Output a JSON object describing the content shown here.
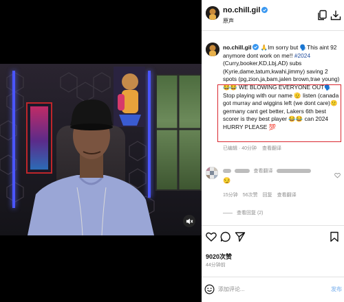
{
  "video": {
    "mute_icon": "speaker-muted-icon"
  },
  "header": {
    "username": "no.chill.gil",
    "subtitle": "原声",
    "icons": [
      "copy-icon",
      "download-icon"
    ]
  },
  "post": {
    "username": "no.chill.gil",
    "caption_part1": "🙏Im sorry but 🗣️This aint 92 anymore dont work on me!! ",
    "hashtag": "#2024",
    "caption_part2": " (Curry,booker,KD,Lbj,AD) subs (Kyrie,dame,tatum,kwahi,jimmy) saving 2 spots ",
    "caption_highlight": "(pg,zion,ja,bam,jalen brown,trae young) 😂😂 WE BLOWING EVERYONE OUT🗣️Stop playing with our name 🫡 listen (canada got murray and wiggins left (we dont care)🙂germany cant get better, Lakers 6th best scorer is they best player 😂😂 can 2024 HURRY PLEASE 💯",
    "meta": "已编辑 · 40分钟",
    "see_translation": "查看翻译"
  },
  "comment": {
    "see_translation": "查看翻译",
    "emoji": "😏",
    "time": "15分钟",
    "likes": "56次赞",
    "reply": "回复",
    "see_translation2": "查看翻译",
    "view_replies": "查看回复 (2)"
  },
  "actions": {
    "like_count": "9020次赞",
    "time_ago": "44分钟前"
  },
  "composer": {
    "placeholder": "添加评论...",
    "post_label": "发布"
  },
  "colors": {
    "highlight_border": "#d9262e",
    "hashtag": "#1e4a9b",
    "verified": "#3897f0"
  }
}
